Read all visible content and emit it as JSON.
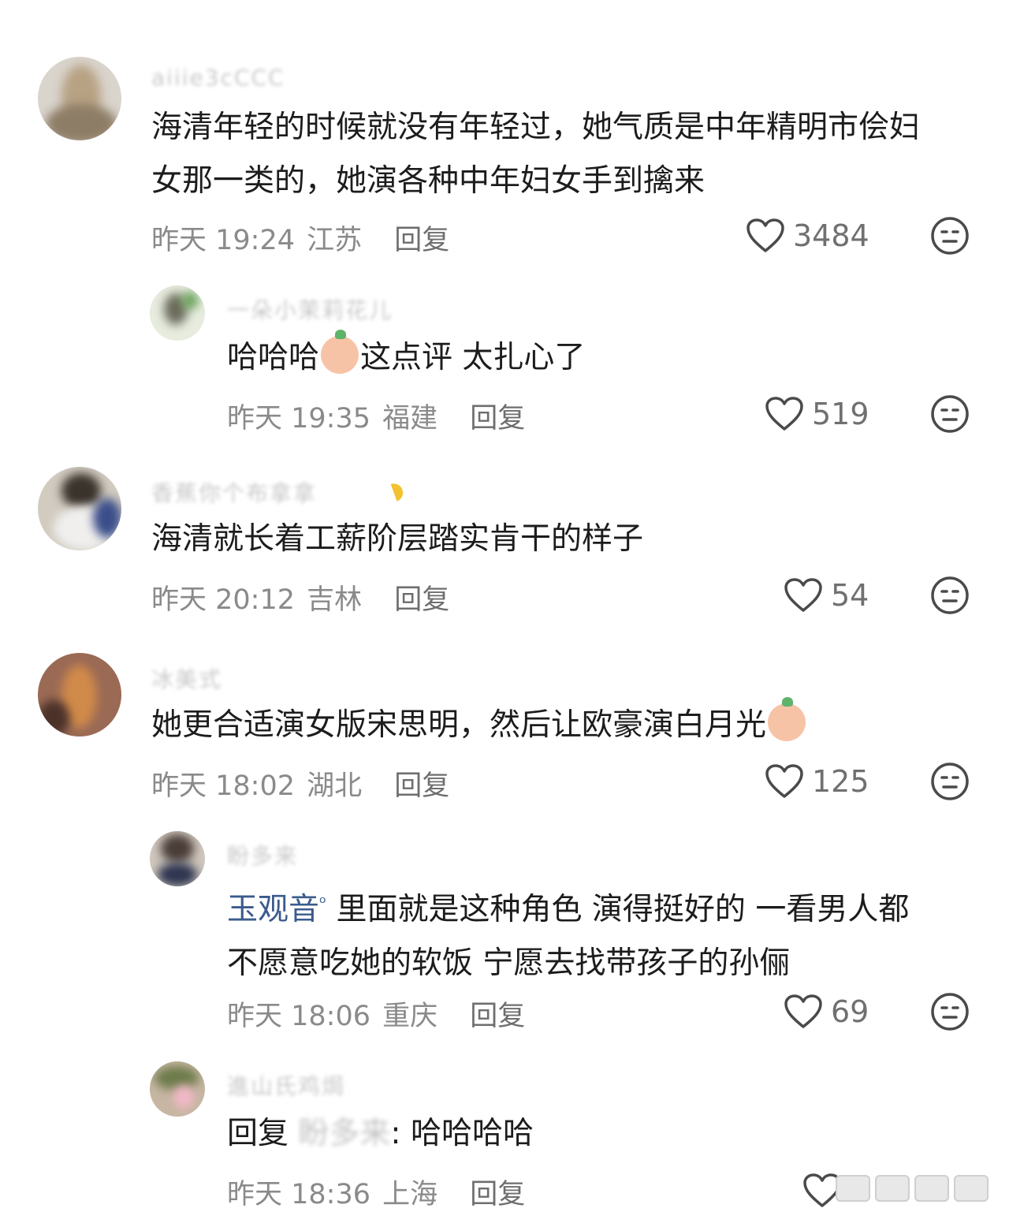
{
  "comments": [
    {
      "username": "aiiie3cCCC",
      "lines": [
        "海清年轻的时候就没有年轻过，她气质是中年精明市侩妇",
        "女那一类的，她演各种中年妇女手到擒来"
      ],
      "time": "昨天 19:24",
      "location": "江苏",
      "reply": "回复",
      "likes": "3484"
    },
    {
      "username": "一朵小茉莉花儿",
      "pre": "哈哈哈",
      "post": "这点评  太扎心了",
      "time": "昨天 19:35",
      "location": "福建",
      "reply": "回复",
      "likes": "519"
    },
    {
      "username": "香蕉你个布拿拿",
      "text": "海清就长着工薪阶层踏实肯干的样子",
      "time": "昨天 20:12",
      "location": "吉林",
      "reply": "回复",
      "likes": "54"
    },
    {
      "username": "冰美式",
      "text": "她更合适演女版宋思明，然后让欧豪演白月光",
      "time": "昨天 18:02",
      "location": "湖北",
      "reply": "回复",
      "likes": "125"
    },
    {
      "username": "盼多来",
      "mention": "玉观音",
      "line1": " 里面就是这种角色 演得挺好的 一看男人都",
      "line2": "不愿意吃她的软饭 宁愿去找带孩子的孙俪",
      "time": "昨天 18:06",
      "location": "重庆",
      "reply": "回复",
      "likes": "69"
    },
    {
      "username": "進山氏鸡焗",
      "reply_prefix": "回复 ",
      "reply_target": "盼多来",
      "reply_text": ": 哈哈哈哈",
      "time": "昨天 18:36",
      "location": "上海",
      "reply": "回复"
    }
  ]
}
